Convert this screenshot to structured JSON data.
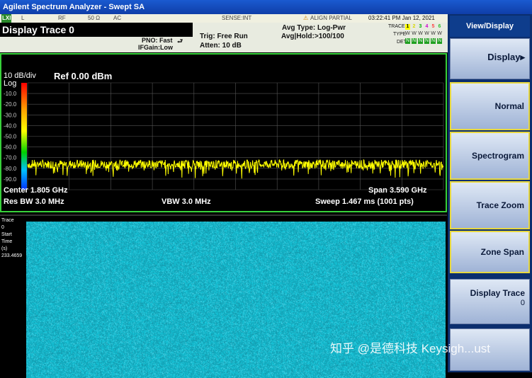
{
  "window_title": "Agilent Spectrum Analyzer - Swept SA",
  "status": {
    "lxi": "LXI",
    "input": "L",
    "rf": "RF",
    "impedance": "50 Ω",
    "coupling": "AC",
    "sense": "SENSE:INT",
    "align": "ALIGN PARTIAL",
    "timestamp": "03:22:41 PM Jan 12, 2021"
  },
  "header": {
    "display_title": "Display Trace 0",
    "pno": "PNO: Fast",
    "ifgain": "IFGain:Low",
    "trig": "Trig: Free Run",
    "atten": "Atten: 10 dB",
    "avg_type": "Avg Type: Log-Pwr",
    "avg_hold": "Avg|Hold:>100/100",
    "trace_label": "TRACE",
    "type_label": "TYPE",
    "det_label": "DET",
    "trace_numbers": [
      "1",
      "2",
      "3",
      "4",
      "5",
      "6"
    ],
    "type_letters": [
      "W",
      "W",
      "W",
      "W",
      "W",
      "W"
    ],
    "det_letters": [
      "N",
      "N",
      "N",
      "N",
      "N",
      "N"
    ]
  },
  "graticule": {
    "scale": "10 dB/div",
    "ref": "Ref 0.00 dBm",
    "log": "Log",
    "y_ticks": [
      "-10.0",
      "-20.0",
      "-30.0",
      "-40.0",
      "-50.0",
      "-60.0",
      "-70.0",
      "-80.0",
      "-90.0"
    ],
    "center": "Center 1.805 GHz",
    "span": "Span 3.590 GHz",
    "res_bw": "Res BW 3.0 MHz",
    "vbw": "VBW 3.0 MHz",
    "sweep": "Sweep  1.467 ms (1001 pts)",
    "noise_floor_dbm": -76
  },
  "spectrogram": {
    "trace_label": [
      "Trace",
      "0",
      "Start",
      "Time",
      "(s)",
      "233.4659"
    ]
  },
  "softkeys": {
    "menu_title": "View/Display",
    "display": "Display▸",
    "normal": "Normal",
    "spectrogram": "Spectrogram",
    "trace_zoom": "Trace Zoom",
    "zone_span": "Zone Span",
    "display_trace": "Display Trace",
    "display_trace_value": "0"
  },
  "watermark": "知乎 @是德科技 Keysigh...ust"
}
